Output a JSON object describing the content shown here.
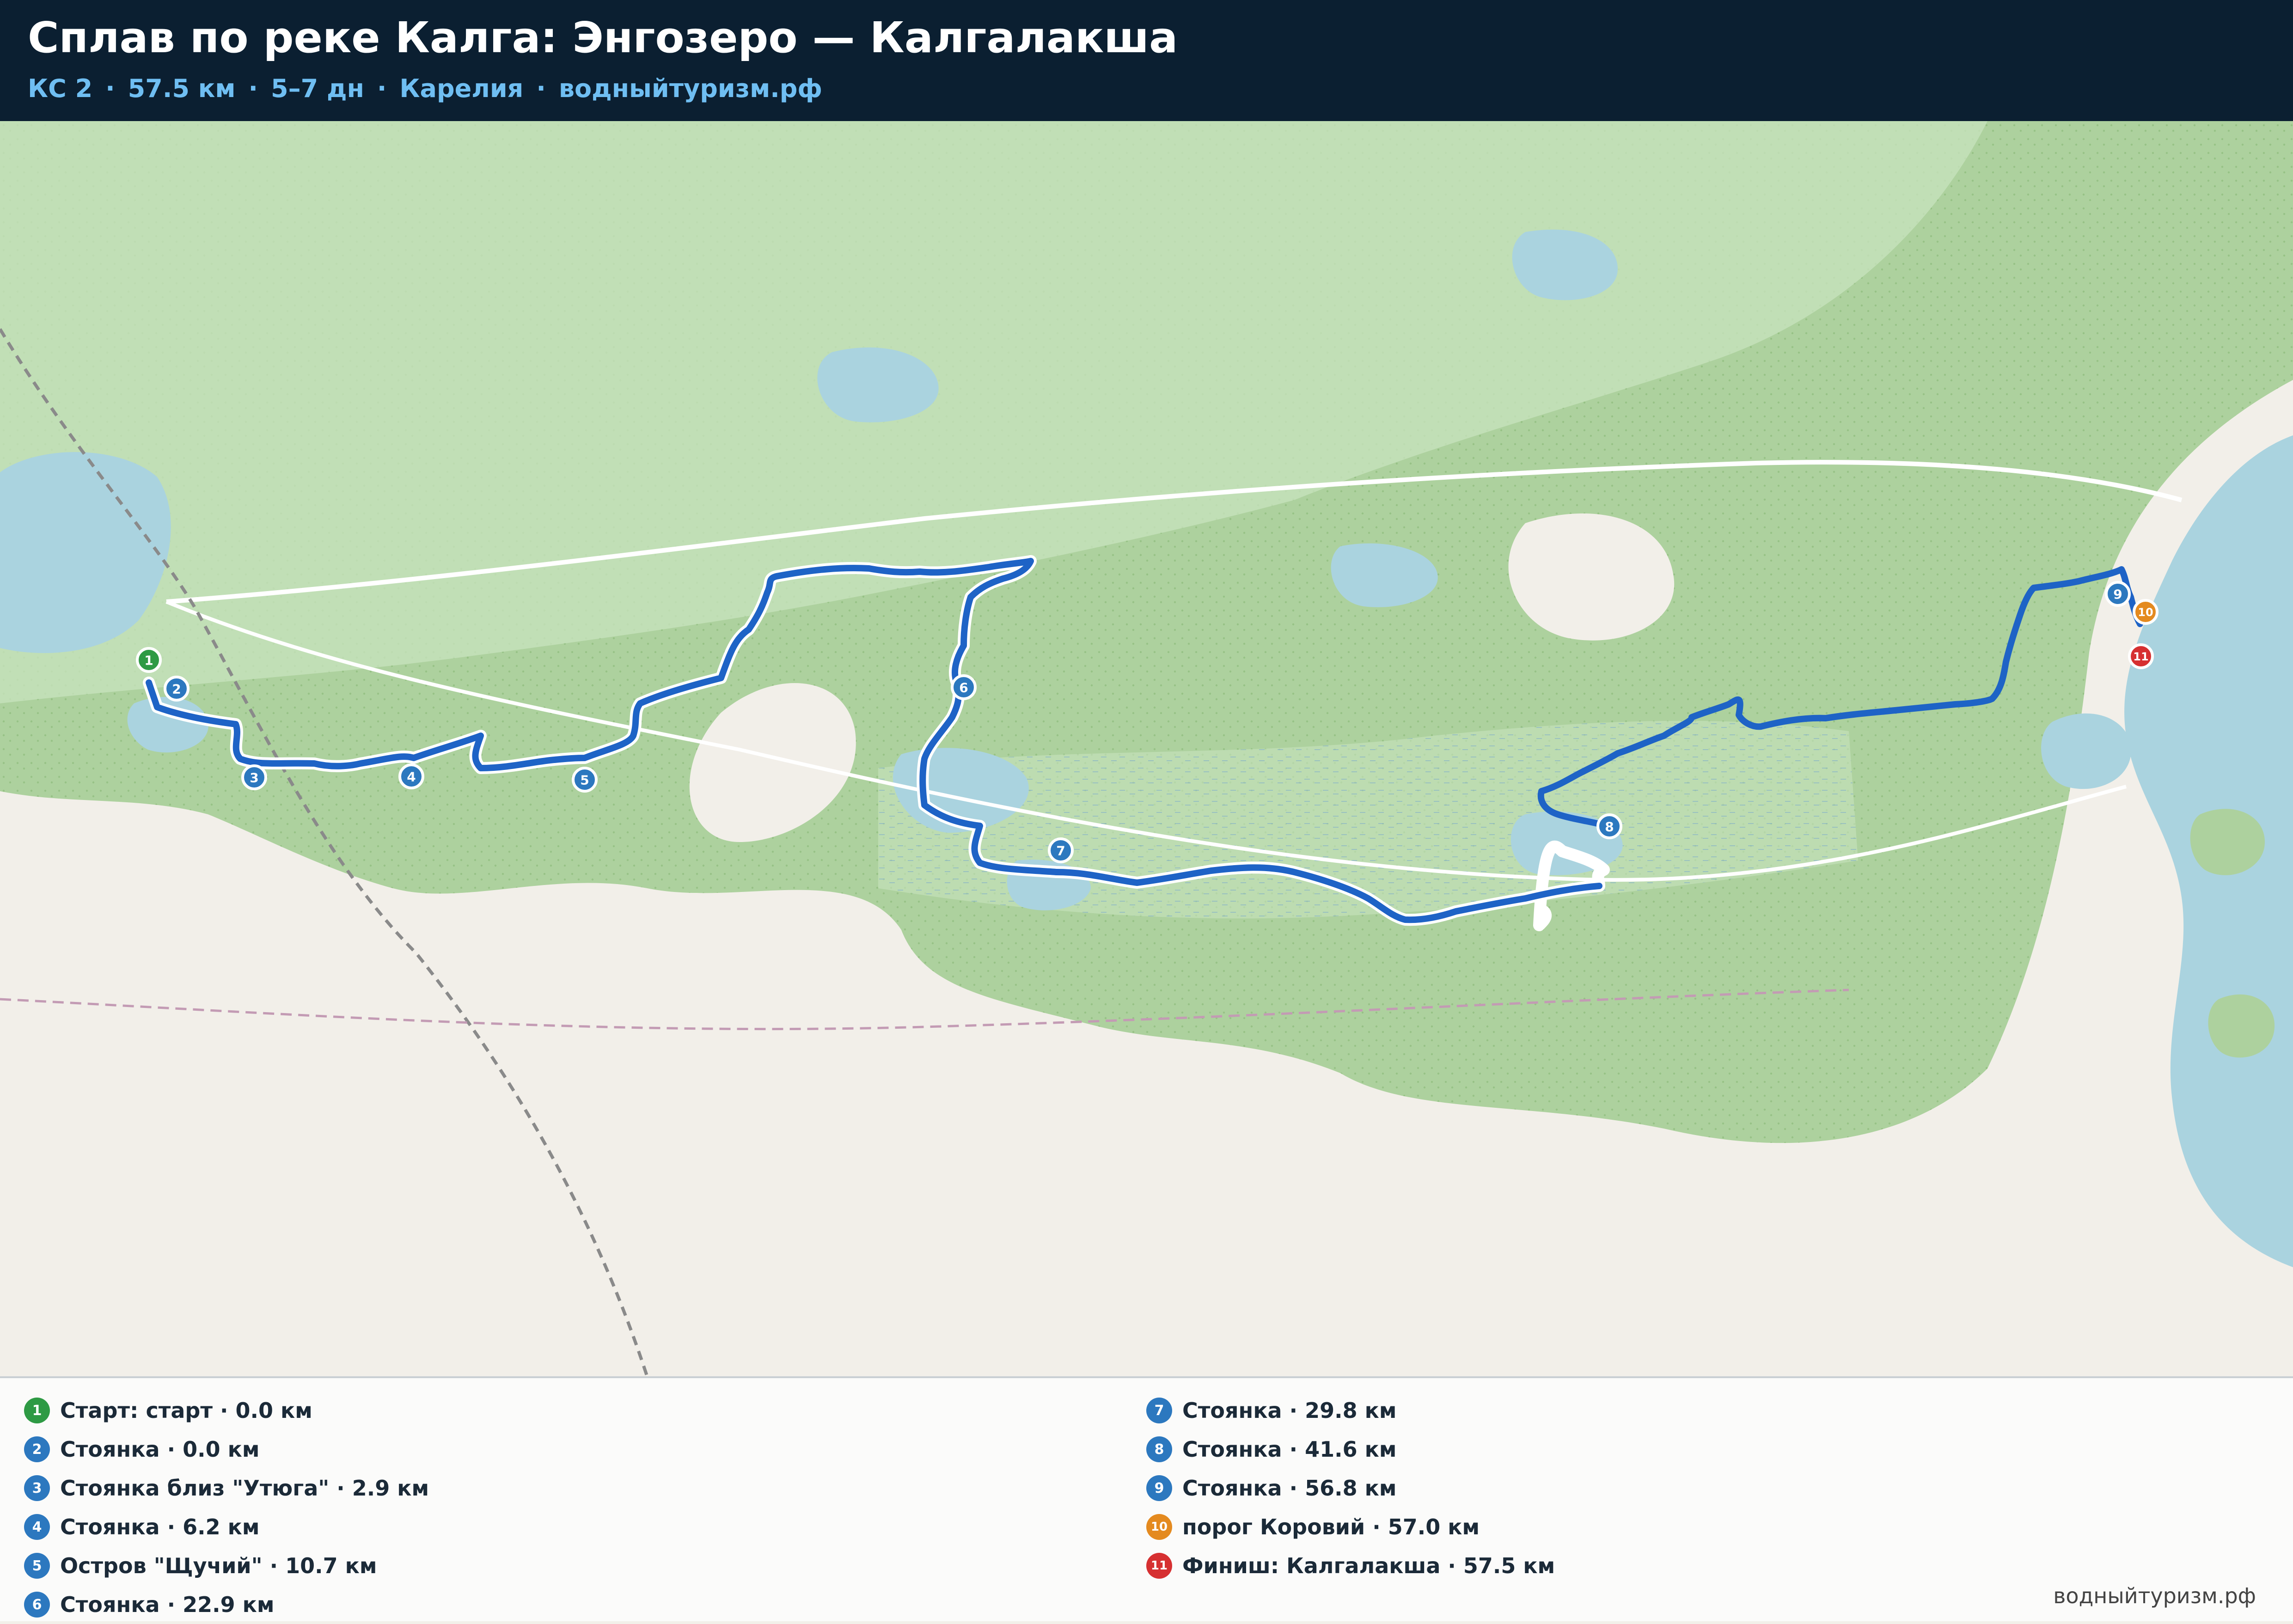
{
  "header": {
    "title": "Сплав по реке Калга: Энгозеро — Калгалакша",
    "subtitle": {
      "category": "КС 2",
      "length": "57.5 км",
      "duration": "5–7 дн",
      "region": "Карелия",
      "site": "водныйтуризм.рф"
    }
  },
  "colors": {
    "header_bg": "#0b1f31",
    "subtitle": "#6fbef2",
    "route": "#1e63c6",
    "start": "#2e9a44",
    "camp": "#2c78bf",
    "rapid": "#e48a1f",
    "finish": "#d63031",
    "water": "#aad3df",
    "forest": "#add19e",
    "land": "#f2efe9"
  },
  "map": {
    "markers": [
      {
        "num": "1",
        "kind": "start"
      },
      {
        "num": "2",
        "kind": "camp"
      },
      {
        "num": "3",
        "kind": "camp"
      },
      {
        "num": "4",
        "kind": "camp"
      },
      {
        "num": "5",
        "kind": "camp"
      },
      {
        "num": "6",
        "kind": "camp"
      },
      {
        "num": "7",
        "kind": "camp"
      },
      {
        "num": "8",
        "kind": "camp"
      },
      {
        "num": "9",
        "kind": "camp"
      },
      {
        "num": "10",
        "kind": "rapid"
      },
      {
        "num": "11",
        "kind": "finish"
      }
    ]
  },
  "legend": {
    "items": [
      {
        "num": "1",
        "kind": "start",
        "label": "Старт: старт · 0.0 км"
      },
      {
        "num": "2",
        "kind": "camp",
        "label": "Стоянка · 0.0 км"
      },
      {
        "num": "3",
        "kind": "camp",
        "label": "Стоянка близ \"Утюга\" · 2.9 км"
      },
      {
        "num": "4",
        "kind": "camp",
        "label": "Стоянка · 6.2 км"
      },
      {
        "num": "5",
        "kind": "camp",
        "label": "Остров \"Щучий\" · 10.7 км"
      },
      {
        "num": "6",
        "kind": "camp",
        "label": "Стоянка · 22.9 км"
      },
      {
        "num": "7",
        "kind": "camp",
        "label": "Стоянка · 29.8 км"
      },
      {
        "num": "8",
        "kind": "camp",
        "label": "Стоянка · 41.6 км"
      },
      {
        "num": "9",
        "kind": "camp",
        "label": "Стоянка · 56.8 км"
      },
      {
        "num": "10",
        "kind": "rapid",
        "label": "порог Коровий · 57.0 км"
      },
      {
        "num": "11",
        "kind": "finish",
        "label": "Финиш: Калгалакша · 57.5 км"
      }
    ],
    "credit": "водныйтуризм.рф"
  }
}
